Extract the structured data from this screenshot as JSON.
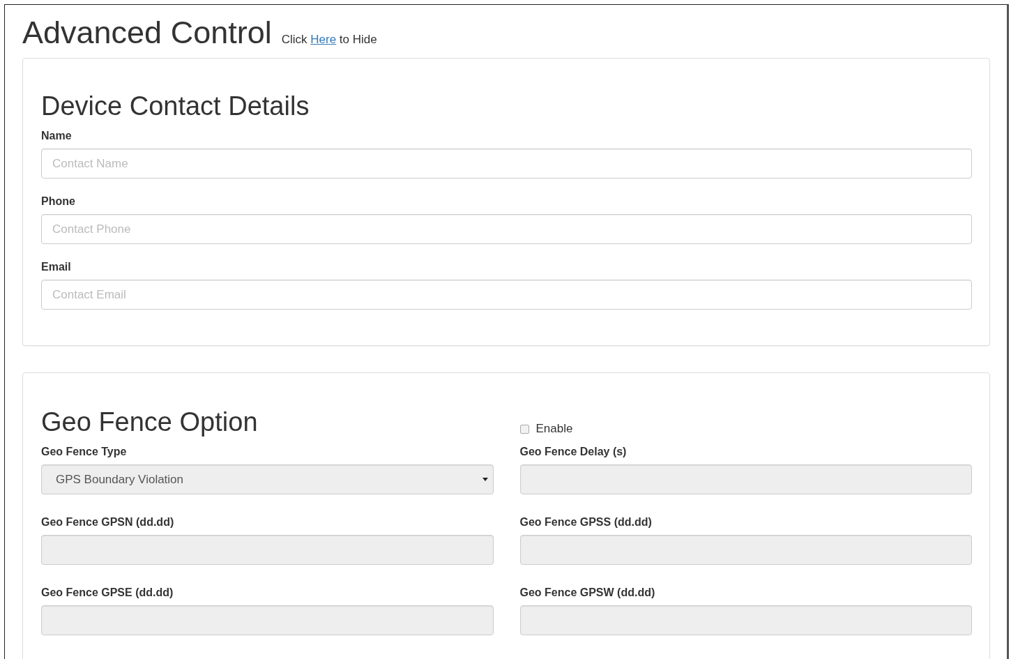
{
  "header": {
    "title": "Advanced Control",
    "hint_before": "Click ",
    "link": "Here",
    "hint_after": " to Hide"
  },
  "contact": {
    "title": "Device Contact Details",
    "fields": [
      {
        "label": "Name",
        "placeholder": "Contact Name"
      },
      {
        "label": "Phone",
        "placeholder": "Contact Phone"
      },
      {
        "label": "Email",
        "placeholder": "Contact Email"
      }
    ]
  },
  "geofence": {
    "title": "Geo Fence Option",
    "enable": {
      "label": "Enable",
      "checked": false
    },
    "fields": [
      {
        "kind": "select",
        "label": "Geo Fence Type",
        "value": "GPS Boundary Violation",
        "disabled": true
      },
      {
        "kind": "input",
        "label": "Geo Fence Delay (s)",
        "disabled": true
      },
      {
        "kind": "input",
        "label": "Geo Fence GPSN (dd.dd)",
        "disabled": true
      },
      {
        "kind": "input",
        "label": "Geo Fence GPSS (dd.dd)",
        "disabled": true
      },
      {
        "kind": "input",
        "label": "Geo Fence GPSE (dd.dd)",
        "disabled": true
      },
      {
        "kind": "input",
        "label": "Geo Fence GPSW (dd.dd)",
        "disabled": true
      }
    ]
  }
}
